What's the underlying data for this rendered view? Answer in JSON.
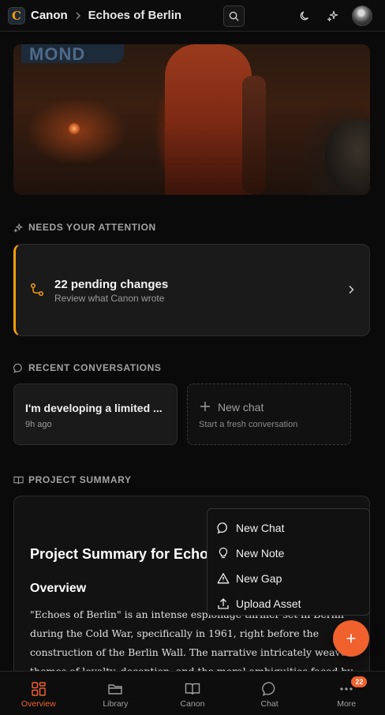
{
  "header": {
    "app_name": "Canon",
    "logo_letter": "C",
    "project_name": "Echoes of Berlin",
    "icons": [
      "search-icon",
      "moon-icon",
      "sparkles-icon",
      "avatar"
    ]
  },
  "hero": {
    "sign_text": "MOND"
  },
  "attention": {
    "section_title": "NEEDS YOUR ATTENTION",
    "card_title": "22 pending changes",
    "card_subtitle": "Review what Canon wrote"
  },
  "conversations": {
    "section_title": "RECENT CONVERSATIONS",
    "items": [
      {
        "title": "I'm developing a limited ...",
        "time": "9h ago"
      }
    ],
    "new_chat": {
      "title": "New chat",
      "subtitle": "Start a fresh conversation"
    }
  },
  "summary": {
    "section_title": "PROJECT SUMMARY",
    "heading": "Project Summary for Echoes of Berlin",
    "subheading": "Overview",
    "body": "\"Echoes of Berlin\" is an intense espionage thriller set in Berlin during the Cold War, specifically in 1961, right before the construction of the Berlin Wall. The narrative intricately weaves themes of loyalty, deception, and the moral ambiguities faced by agents navigating a dangerous world"
  },
  "fab_menu": {
    "items": [
      {
        "label": "New Chat",
        "icon": "chat-icon"
      },
      {
        "label": "New Note",
        "icon": "lightbulb-icon"
      },
      {
        "label": "New Gap",
        "icon": "warning-icon"
      },
      {
        "label": "Upload Asset",
        "icon": "upload-icon"
      }
    ]
  },
  "bottom_nav": {
    "items": [
      {
        "label": "Overview",
        "icon": "grid-icon",
        "active": true
      },
      {
        "label": "Library",
        "icon": "folder-icon"
      },
      {
        "label": "Canon",
        "icon": "book-icon"
      },
      {
        "label": "Chat",
        "icon": "chat-icon"
      },
      {
        "label": "More",
        "icon": "more-icon",
        "badge": "22"
      }
    ]
  },
  "colors": {
    "accent": "#f0612e",
    "attention": "#f59e0b",
    "background": "#0a0a0a",
    "card": "#1a1a1a"
  }
}
